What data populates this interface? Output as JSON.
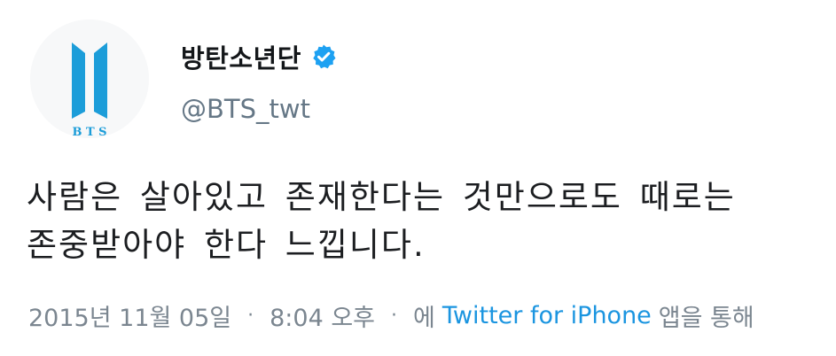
{
  "tweet": {
    "avatar": {
      "logo_text": "B T S",
      "logo_color": "#1c9dd9"
    },
    "display_name": "방탄소년단",
    "verified": true,
    "verified_color": "#1da1f2",
    "handle": "@BTS_twt",
    "text": "사람은 살아있고 존재한다는 것만으로도 때로는\n존중받아야 한다 느낍니다.",
    "date": "2015년 11월 05일",
    "separator": "·",
    "time": "8:04 오후",
    "via_prefix": "에",
    "source": "Twitter for iPhone",
    "via_suffix": "앱을 통해",
    "link_color": "#1b95e0"
  }
}
